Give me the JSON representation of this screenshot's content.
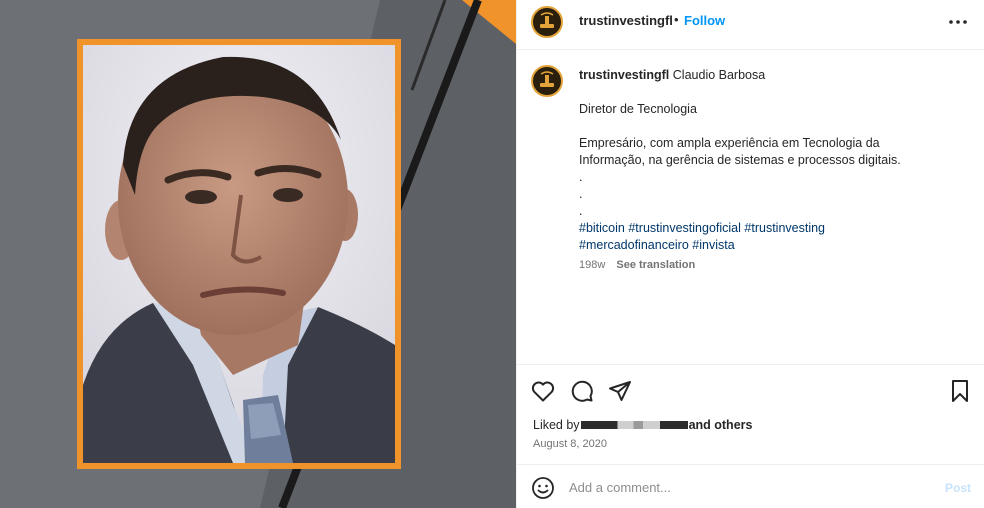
{
  "post": {
    "username": "trustinvestingfl",
    "follow_label": "Follow",
    "separator": "•"
  },
  "caption": {
    "username": "trustinvestingfl",
    "name": "Claudio Barbosa",
    "role": "Diretor de Tecnologia",
    "body_line1": "Empresário, com ampla experiência em Tecnologia da",
    "body_line2": "Informação, na gerência de sistemas e processos digitais.",
    "dots": [
      ".",
      ".",
      "."
    ],
    "hashtags": [
      "#biticoin",
      "#trustinvestingoficial",
      "#trustinvesting",
      "#mercadofinanceiro",
      "#invista"
    ],
    "age": "198w",
    "see_translation": "See translation"
  },
  "engagement": {
    "liked_by_prefix": "Liked by",
    "liked_by_suffix": "and others",
    "date": "August 8, 2020"
  },
  "comment_box": {
    "placeholder": "Add a comment...",
    "post_label": "Post"
  },
  "icons": {
    "more": "more-options-icon",
    "like": "heart-icon",
    "comment": "comment-bubble-icon",
    "share": "paper-plane-icon",
    "save": "bookmark-icon",
    "emoji": "emoji-smile-icon"
  },
  "colors": {
    "accent": "#0095f6",
    "frame": "#f0932b",
    "hashtag": "#00376b",
    "muted": "#737373"
  }
}
